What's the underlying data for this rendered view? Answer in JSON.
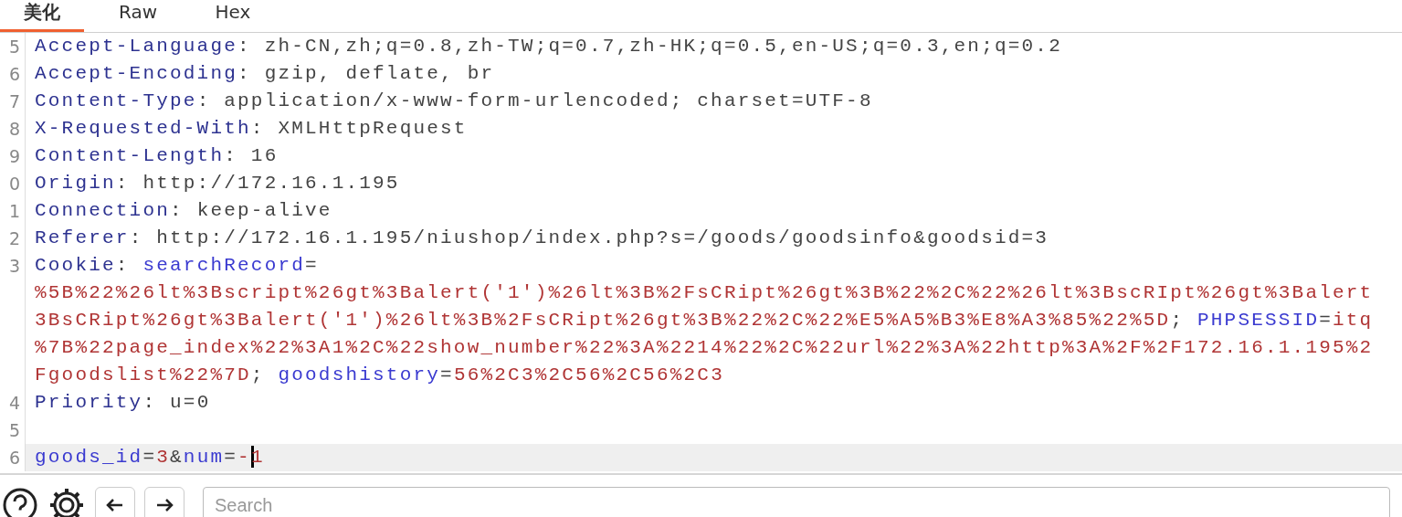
{
  "tabs": [
    {
      "label": "美化",
      "selected": true
    },
    {
      "label": "Raw",
      "selected": false
    },
    {
      "label": "Hex",
      "selected": false
    }
  ],
  "lines": [
    {
      "number": "5",
      "current": false,
      "tokens": [
        {
          "kind": "key",
          "text": "Accept-Language"
        },
        {
          "kind": "plain",
          "text": ": zh-CN,zh;q=0.8,zh-TW;q=0.7,zh-HK;q=0.5,en-US;q=0.3,en;q=0.2"
        }
      ]
    },
    {
      "number": "6",
      "current": false,
      "tokens": [
        {
          "kind": "key",
          "text": "Accept-Encoding"
        },
        {
          "kind": "plain",
          "text": ": gzip, deflate, br"
        }
      ]
    },
    {
      "number": "7",
      "current": false,
      "tokens": [
        {
          "kind": "key",
          "text": "Content-Type"
        },
        {
          "kind": "plain",
          "text": ": application/x-www-form-urlencoded; charset=UTF-8"
        }
      ]
    },
    {
      "number": "8",
      "current": false,
      "tokens": [
        {
          "kind": "key",
          "text": "X-Requested-With"
        },
        {
          "kind": "plain",
          "text": ": XMLHttpRequest"
        }
      ]
    },
    {
      "number": "9",
      "current": false,
      "tokens": [
        {
          "kind": "key",
          "text": "Content-Length"
        },
        {
          "kind": "plain",
          "text": ": 16"
        }
      ]
    },
    {
      "number": "0",
      "current": false,
      "tokens": [
        {
          "kind": "key",
          "text": "Origin"
        },
        {
          "kind": "plain",
          "text": ": http://172.16.1.195"
        }
      ]
    },
    {
      "number": "1",
      "current": false,
      "tokens": [
        {
          "kind": "key",
          "text": "Connection"
        },
        {
          "kind": "plain",
          "text": ": keep-alive"
        }
      ]
    },
    {
      "number": "2",
      "current": false,
      "tokens": [
        {
          "kind": "key",
          "text": "Referer"
        },
        {
          "kind": "plain",
          "text": ": http://172.16.1.195/niushop/index.php?s=/goods/goodsinfo&goodsid=3"
        }
      ]
    },
    {
      "number": "3",
      "current": false,
      "tokens": [
        {
          "kind": "key",
          "text": "Cookie"
        },
        {
          "kind": "plain",
          "text": ": "
        },
        {
          "kind": "name",
          "text": "searchRecord"
        },
        {
          "kind": "plain",
          "text": "="
        }
      ],
      "wrapped_rows": [
        {
          "tokens": [
            {
              "kind": "value",
              "text": "%5B%22%26lt%3Bscript%26gt%3Balert('1')%26lt%3B%2FsCRipt%26gt%3B%22%2C%22%26lt%3BscRIpt%26gt%3Balert"
            }
          ]
        },
        {
          "tokens": [
            {
              "kind": "value",
              "text": "3BsCRipt%26gt%3Balert('1')%26lt%3B%2FsCRipt%26gt%3B%22%2C%22%E5%A5%B3%E8%A3%85%22%5D"
            },
            {
              "kind": "plain",
              "text": "; "
            },
            {
              "kind": "name",
              "text": "PHPSESSID"
            },
            {
              "kind": "plain",
              "text": "="
            },
            {
              "kind": "value",
              "text": "itq"
            }
          ]
        },
        {
          "tokens": [
            {
              "kind": "value",
              "text": "%7B%22page_index%22%3A1%2C%22show_number%22%3A%2214%22%2C%22url%22%3A%22http%3A%2F%2F172.16.1.195%2"
            }
          ]
        },
        {
          "tokens": [
            {
              "kind": "value",
              "text": "Fgoodslist%22%7D"
            },
            {
              "kind": "plain",
              "text": "; "
            },
            {
              "kind": "name",
              "text": "goodshistory"
            },
            {
              "kind": "plain",
              "text": "="
            },
            {
              "kind": "value",
              "text": "56%2C3%2C56%2C56%2C3"
            }
          ]
        }
      ]
    },
    {
      "number": "4",
      "current": false,
      "tokens": [
        {
          "kind": "key",
          "text": "Priority"
        },
        {
          "kind": "plain",
          "text": ": u=0"
        }
      ]
    },
    {
      "number": "5",
      "current": false
    },
    {
      "number": "6",
      "current": true,
      "tokens": [
        {
          "kind": "name",
          "text": "goods_id"
        },
        {
          "kind": "plain",
          "text": "="
        },
        {
          "kind": "value",
          "text": "3"
        },
        {
          "kind": "plain",
          "text": "&"
        },
        {
          "kind": "name",
          "text": "num"
        },
        {
          "kind": "plain",
          "text": "="
        },
        {
          "kind": "value",
          "text": "-"
        },
        {
          "kind": "value",
          "text": "1",
          "caret": true
        }
      ]
    }
  ],
  "search": {
    "placeholder": "Search"
  }
}
